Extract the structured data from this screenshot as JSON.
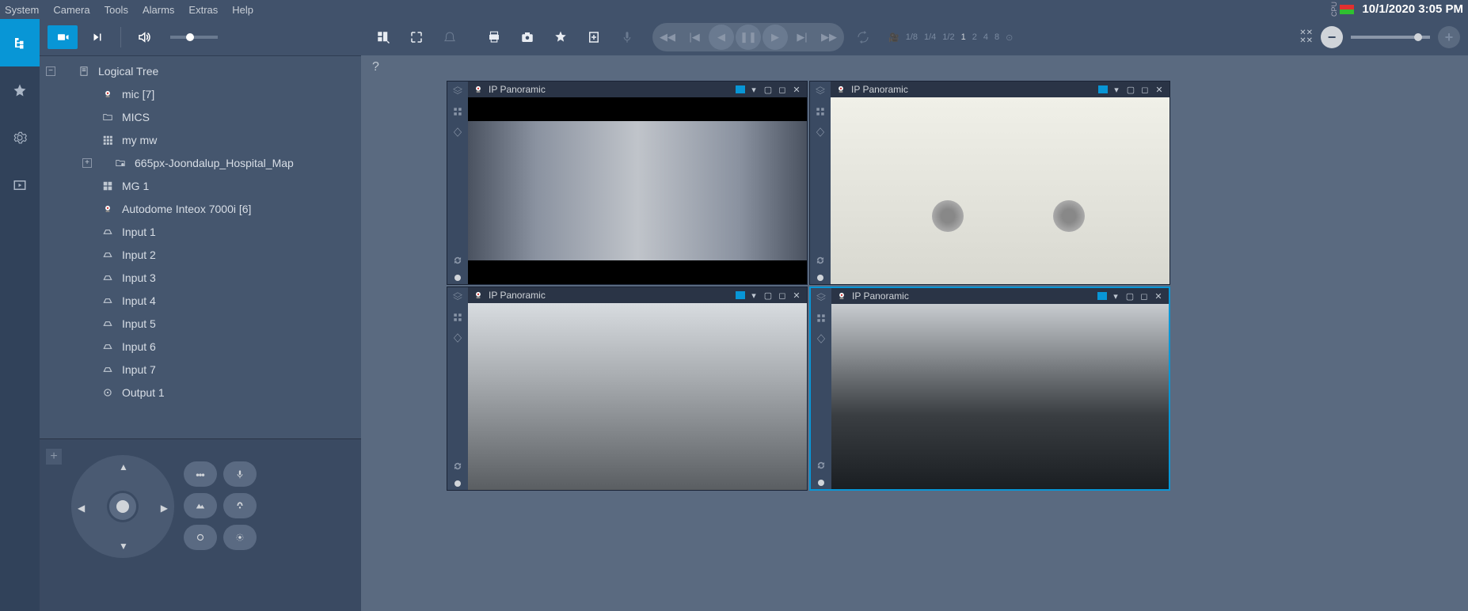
{
  "menu": {
    "items": [
      "System",
      "Camera",
      "Tools",
      "Alarms",
      "Extras",
      "Help"
    ],
    "cpu_label": "CPU",
    "datetime": "10/1/2020 3:05 PM"
  },
  "tree": {
    "root_label": "Logical Tree",
    "items": [
      {
        "label": "mic [7]",
        "icon": "camera"
      },
      {
        "label": "MICS",
        "icon": "folder"
      },
      {
        "label": "my  mw",
        "icon": "grid"
      },
      {
        "label": "665px-Joondalup_Hospital_Map",
        "icon": "map",
        "expandable": true
      },
      {
        "label": "MG 1",
        "icon": "grid4"
      },
      {
        "label": "Autodome Inteox 7000i [6]",
        "icon": "camera"
      },
      {
        "label": "Input 1",
        "icon": "input"
      },
      {
        "label": "Input 2",
        "icon": "input"
      },
      {
        "label": "Input 3",
        "icon": "input"
      },
      {
        "label": "Input 4",
        "icon": "input"
      },
      {
        "label": "Input 5",
        "icon": "input"
      },
      {
        "label": "Input 6",
        "icon": "input"
      },
      {
        "label": "Input 7",
        "icon": "input"
      },
      {
        "label": "Output 1",
        "icon": "output"
      }
    ]
  },
  "speed_labels": [
    "1/8",
    "1/4",
    "1/2",
    "1",
    "2",
    "4",
    "8"
  ],
  "help_label": "?",
  "panes": [
    {
      "title": "IP Panoramic"
    },
    {
      "title": "IP Panoramic"
    },
    {
      "title": "IP Panoramic"
    },
    {
      "title": "IP Panoramic"
    }
  ]
}
